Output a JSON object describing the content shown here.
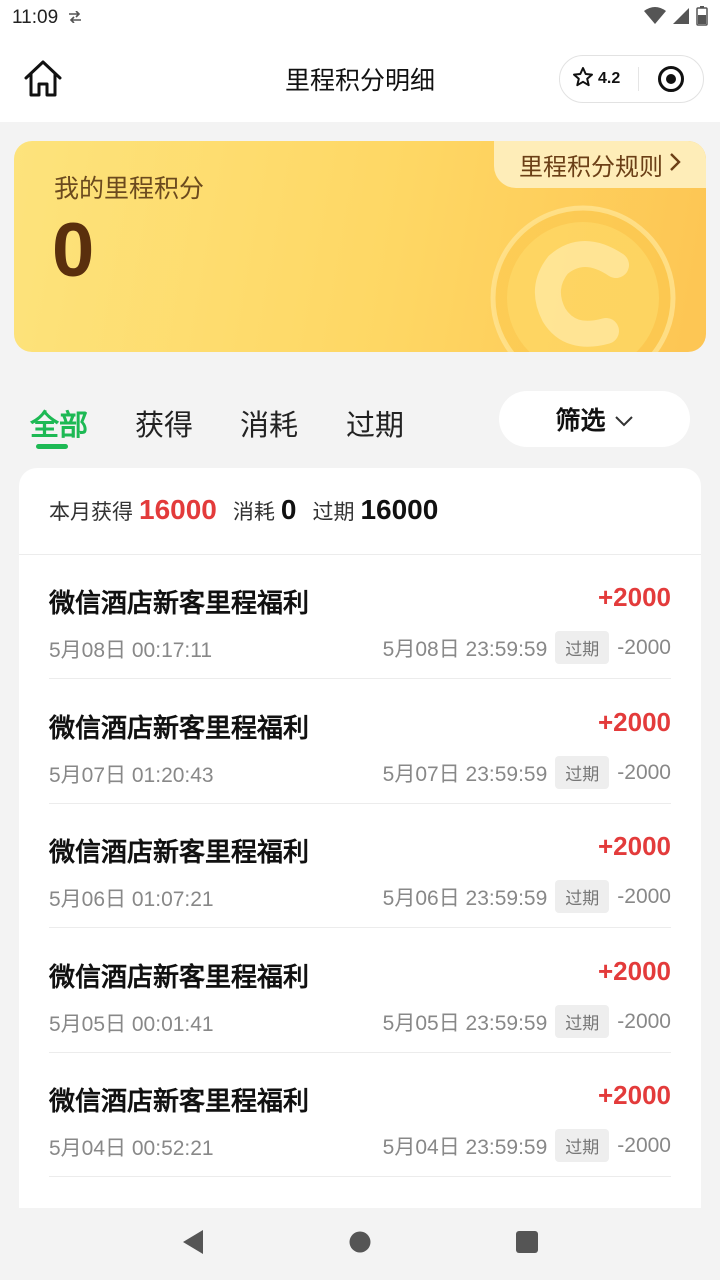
{
  "status_bar": {
    "time": "11:09",
    "sync_icon": "sync-icon",
    "icons": [
      "wifi-icon",
      "signal-icon",
      "battery-icon"
    ]
  },
  "header": {
    "title": "里程积分明细",
    "rating": "4.2",
    "icons": [
      "home-icon",
      "star-icon",
      "target-icon"
    ]
  },
  "card": {
    "label": "我的里程积分",
    "value": "0",
    "rules_link": "里程积分规则"
  },
  "tabs": [
    {
      "label": "全部",
      "active": true
    },
    {
      "label": "获得",
      "active": false
    },
    {
      "label": "消耗",
      "active": false
    },
    {
      "label": "过期",
      "active": false
    }
  ],
  "filter": {
    "label": "筛选",
    "icon": "chevron-down-icon"
  },
  "summary": {
    "earned_label": "本月获得",
    "earned_value": "16000",
    "consumed_label": "消耗",
    "consumed_value": "0",
    "expired_label": "过期",
    "expired_value": "16000"
  },
  "records": [
    {
      "title": "微信酒店新客里程福利",
      "amount": "+2000",
      "time": "5月08日 00:17:11",
      "expire_time": "5月08日 23:59:59",
      "badge": "过期",
      "expire_amount": "-2000"
    },
    {
      "title": "微信酒店新客里程福利",
      "amount": "+2000",
      "time": "5月07日 01:20:43",
      "expire_time": "5月07日 23:59:59",
      "badge": "过期",
      "expire_amount": "-2000"
    },
    {
      "title": "微信酒店新客里程福利",
      "amount": "+2000",
      "time": "5月06日 01:07:21",
      "expire_time": "5月06日 23:59:59",
      "badge": "过期",
      "expire_amount": "-2000"
    },
    {
      "title": "微信酒店新客里程福利",
      "amount": "+2000",
      "time": "5月05日 00:01:41",
      "expire_time": "5月05日 23:59:59",
      "badge": "过期",
      "expire_amount": "-2000"
    },
    {
      "title": "微信酒店新客里程福利",
      "amount": "+2000",
      "time": "5月04日 00:52:21",
      "expire_time": "5月04日 23:59:59",
      "badge": "过期",
      "expire_amount": "-2000"
    }
  ],
  "nav_bar": {
    "icons": [
      "back-icon",
      "home-circle-icon",
      "recents-icon"
    ]
  },
  "colors": {
    "accent_green": "#1db954",
    "amount_red": "#e33b3b",
    "card_yellow": "#fed764"
  }
}
